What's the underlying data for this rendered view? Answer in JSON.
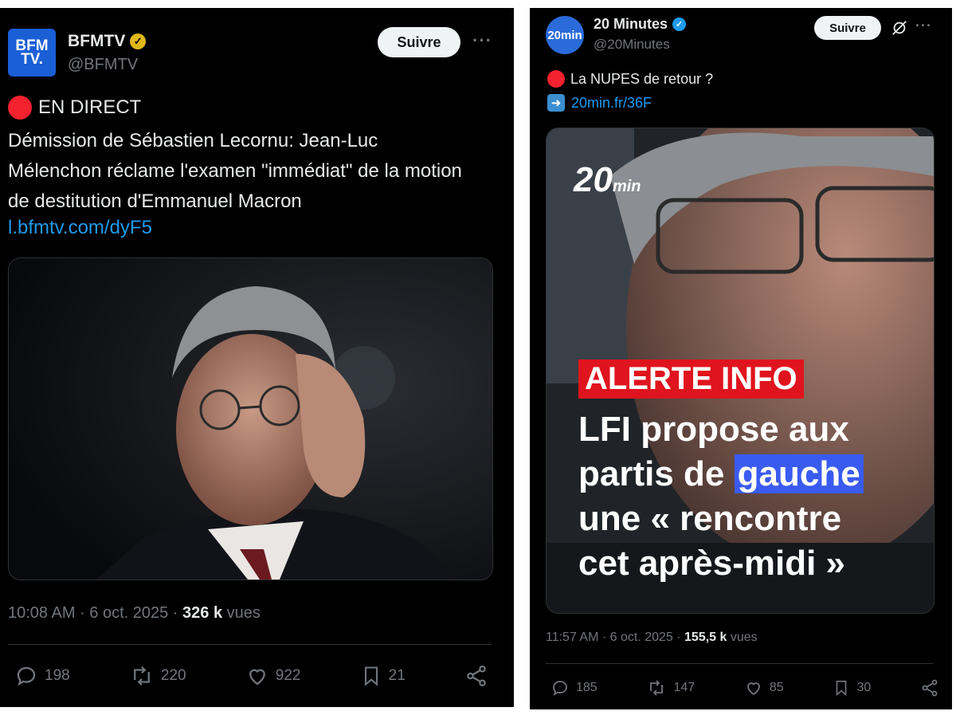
{
  "left": {
    "account_name": "BFMTV",
    "handle": "@BFMTV",
    "avatar_text_line1": "BFM",
    "avatar_text_line2": "TV.",
    "follow_label": "Suivre",
    "more_label": "···",
    "live_label": "EN DIRECT",
    "body": "Démission de Sébastien Lecornu: Jean-Luc Mélenchon réclame l'examen \"immédiat\" de la motion de destitution d'Emmanuel Macron",
    "link": "l.bfmtv.com/dyF5",
    "time": "10:08 AM · 6 oct. 2025 · ",
    "views_count": "326 k",
    "views_label": " vues",
    "actions": {
      "replies": "198",
      "reposts": "220",
      "likes": "922",
      "bookmarks": "21"
    }
  },
  "right": {
    "account_name": "20 Minutes",
    "handle": "@20Minutes",
    "avatar_text": "20min",
    "follow_label": "Suivre",
    "more_label": "···",
    "line1": "La NUPES de retour ?",
    "arrow": "➡",
    "link": "20min.fr/36F",
    "image": {
      "brand": "20",
      "brand_small": "min",
      "alert": "ALERTE INFO",
      "headline_1": "LFI propose aux",
      "headline_2a": "partis de ",
      "headline_2b": "gauche",
      "headline_3": "une « rencontre",
      "headline_4": "cet après-midi »"
    },
    "time": "11:57 AM · 6 oct. 2025 · ",
    "views_count": "155,5 k",
    "views_label": " vues",
    "actions": {
      "replies": "185",
      "reposts": "147",
      "likes": "85",
      "bookmarks": "30"
    }
  },
  "colors": {
    "accent_link": "#1d9bf0",
    "verified_gold": "#e2b719",
    "verified_blue": "#1d9bf0",
    "live_red": "#f4212e",
    "alert_red": "#e0141e",
    "highlight_blue": "#3a5bf0"
  }
}
